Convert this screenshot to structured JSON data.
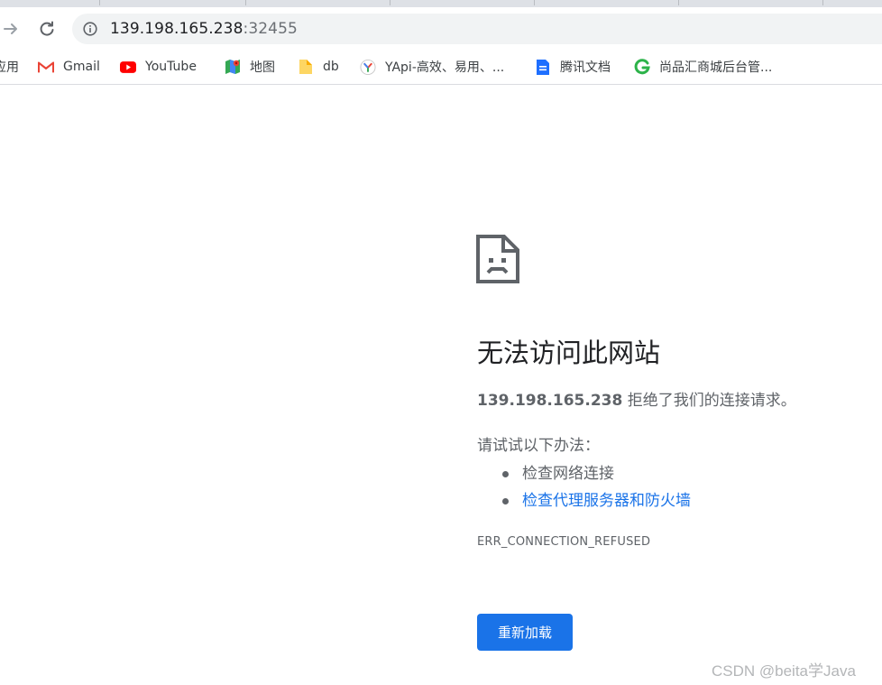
{
  "toolbar": {
    "url_host": "139.198.165.238",
    "url_port": ":32455",
    "icons": [
      "forward-icon",
      "reload-icon",
      "site-info-icon"
    ]
  },
  "bookmarks": [
    {
      "label": "应用",
      "icon": "apps-icon"
    },
    {
      "label": "Gmail",
      "icon": "gmail-icon"
    },
    {
      "label": "YouTube",
      "icon": "youtube-icon"
    },
    {
      "label": "地图",
      "icon": "maps-icon"
    },
    {
      "label": "db",
      "icon": "folder-icon"
    },
    {
      "label": "YApi-高效、易用、...",
      "icon": "yapi-icon"
    },
    {
      "label": "腾讯文档",
      "icon": "tencent-docs-icon"
    },
    {
      "label": "尚品汇商城后台管...",
      "icon": "shangpinhui-icon"
    }
  ],
  "error_page": {
    "title": "无法访问此网站",
    "host": "139.198.165.238",
    "description_rest": " 拒绝了我们的连接请求。",
    "try_label": "请试试以下办法：",
    "suggestions": [
      "检查网络连接",
      "检查代理服务器和防火墙"
    ],
    "error_code": "ERR_CONNECTION_REFUSED",
    "reload_label": "重新加载",
    "icon": "sad-document-icon"
  },
  "colors": {
    "accent": "#1a73e8",
    "text_primary": "#202124",
    "text_secondary": "#5f6368",
    "omnibox_bg": "#f1f3f4"
  },
  "watermark": "CSDN @beita学Java"
}
